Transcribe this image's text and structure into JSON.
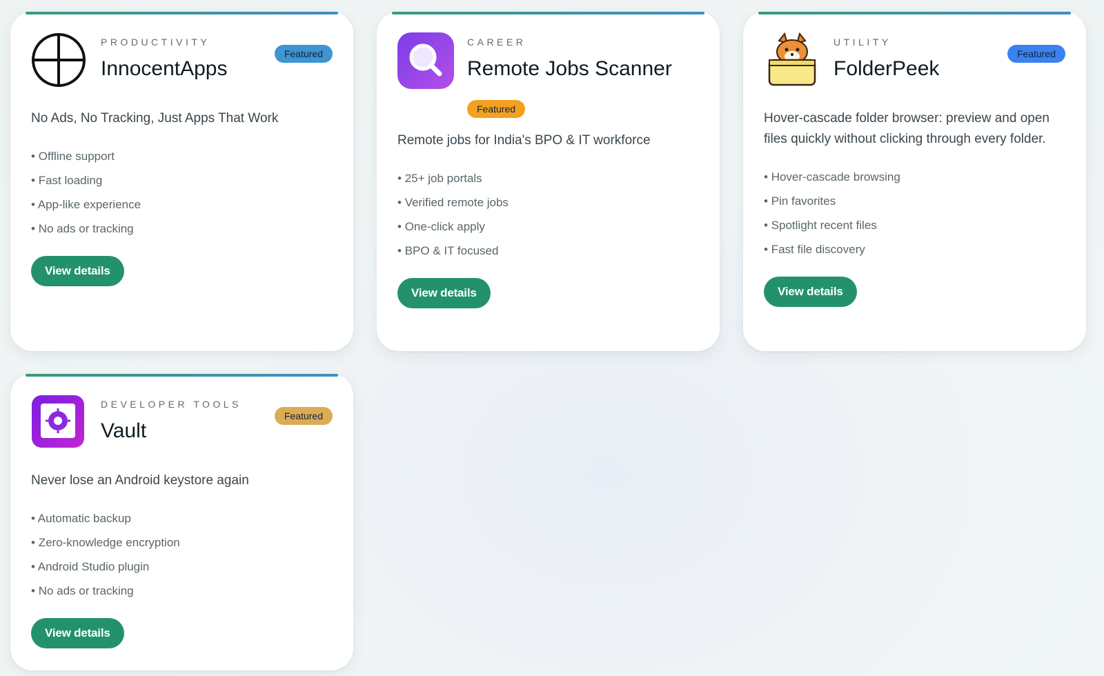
{
  "cards": [
    {
      "category": "PRODUCTIVITY",
      "title": "InnocentApps",
      "badge": "Featured",
      "badge_color": "#3e95d0",
      "description": "No Ads, No Tracking, Just Apps That Work",
      "features": [
        "Offline support",
        "Fast loading",
        "App-like experience",
        "No ads or tracking"
      ],
      "button": "View details",
      "logo_icon": "circle-plus-icon"
    },
    {
      "category": "CAREER",
      "title": "Remote Jobs Scanner",
      "badge": "Featured",
      "badge_color": "#f4a11f",
      "description": "Remote jobs for India's BPO & IT workforce",
      "features": [
        "25+ job portals",
        "Verified remote jobs",
        "One-click apply",
        "BPO & IT focused"
      ],
      "button": "View details",
      "logo_icon": "magnifier-icon"
    },
    {
      "category": "UTILITY",
      "title": "FolderPeek",
      "badge": "Featured",
      "badge_color": "#3b82f0",
      "description": "Hover-cascade folder browser: preview and open files quickly without clicking through every folder.",
      "features": [
        "Hover-cascade browsing",
        "Pin favorites",
        "Spotlight recent files",
        "Fast file discovery"
      ],
      "button": "View details",
      "logo_icon": "fox-in-folder-icon"
    },
    {
      "category": "DEVELOPER TOOLS",
      "title": "Vault",
      "badge": "Featured",
      "badge_color": "#dcab55",
      "description": "Never lose an Android keystore again",
      "features": [
        "Automatic backup",
        "Zero-knowledge encryption",
        "Android Studio plugin",
        "No ads or tracking"
      ],
      "button": "View details",
      "logo_icon": "vault-safe-icon"
    }
  ],
  "button_color": "#23926b"
}
